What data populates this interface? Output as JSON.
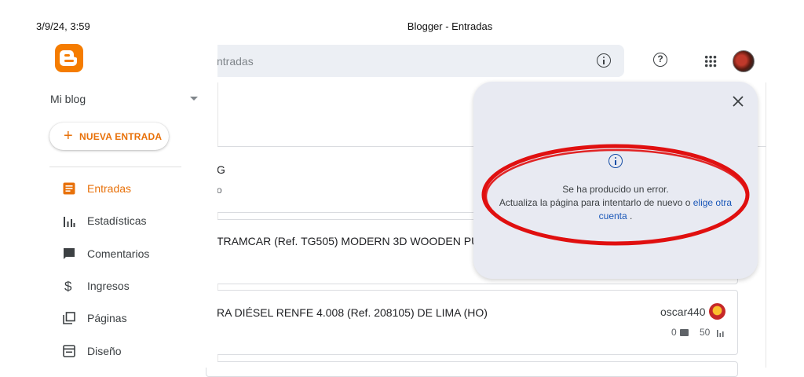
{
  "print_header": {
    "date": "3/9/24, 3:59",
    "title": "Blogger - Entradas"
  },
  "search": {
    "placeholder": "ntradas"
  },
  "sidebar": {
    "blog_name": "Mi blog",
    "new_post_label": "NUEVA ENTRADA",
    "items": [
      {
        "label": "Entradas",
        "icon": "posts-icon",
        "active": true
      },
      {
        "label": "Estadísticas",
        "icon": "stats-icon",
        "active": false
      },
      {
        "label": "Comentarios",
        "icon": "comments-icon",
        "active": false
      },
      {
        "label": "Ingresos",
        "icon": "dollar-icon",
        "active": false
      },
      {
        "label": "Páginas",
        "icon": "pages-icon",
        "active": false
      },
      {
        "label": "Diseño",
        "icon": "layout-icon",
        "active": false
      }
    ]
  },
  "posts": [
    {
      "title": "G",
      "sub": "o"
    },
    {
      "title": "TRAMCAR (Ref. TG505) MODERN 3D WOODEN PUZZ"
    },
    {
      "title": "RA DIÉSEL RENFE 4.008 (Ref. 208105) DE LIMA (HO)",
      "author": "oscar440",
      "comments": "0",
      "views": "50"
    }
  ],
  "error_popup": {
    "line1": "Se ha producido un error.",
    "line2_prefix": "Actualiza la página para intentarlo de nuevo o ",
    "link_part1": "elige otra",
    "link_part2": "cuenta",
    "suffix": " ."
  },
  "colors": {
    "accent": "#e8710a",
    "annotation": "#e01010",
    "link": "#1a57b8"
  }
}
